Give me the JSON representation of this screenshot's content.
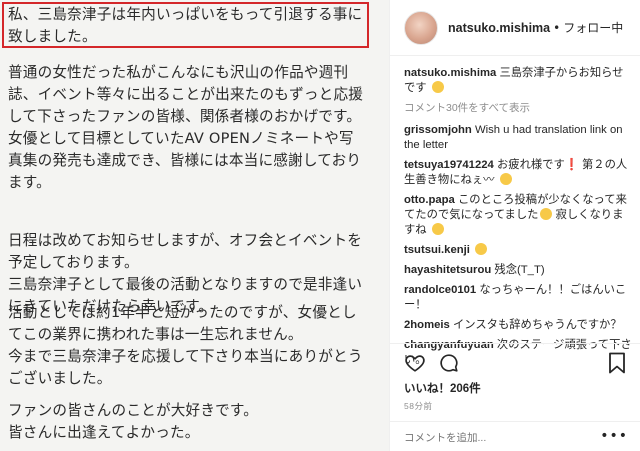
{
  "letter": {
    "highlight": "私、三島奈津子は年内いっぱいをもって引退する事に\n致しました。",
    "para1": "普通の女性だった私がこんなにも沢山の作品や週刊\n誌、イベント等々に出ることが出来たのもずっと応援\nして下さったファンの皆様、関係者様のおかげです。\n女優として目標としていたAV OPENノミネートや写\n真集の発売も達成でき、皆様には本当に感謝しており\nます。",
    "para2": "日程は改めてお知らせしますが、オフ会とイベントを\n予定しております。\n三島奈津子として最後の活動となりますので是非逢い\nにきていただけたら幸いです。",
    "para3": "活動としては約1年半と短かったのですが、女優とし\nてこの業界に携われた事は一生忘れません。\n今まで三島奈津子を応援して下さり本当にありがとう\nございました。",
    "para4": "ファンの皆さんのことが大好きです。\n皆さんに出逢えてよかった。"
  },
  "header": {
    "username": "natsuko.mishima",
    "dot": "•",
    "follow_status": "フォロー中"
  },
  "caption": {
    "user": "natsuko.mishima",
    "text": "三島奈津子からお知らせです"
  },
  "more_comments": "コメント30件をすべて表示",
  "comments": [
    {
      "user": "grissomjohn",
      "text": "Wish u had translation link on the letter"
    },
    {
      "user": "tetsuya19741224",
      "text": "お疲れ様です",
      "mark": "❗",
      "text2": "第２の人生善き物にねぇ〰"
    },
    {
      "user": "otto.papa",
      "text": "このところ投稿が少なくなって来てたので気になってました",
      "text2": "寂しくなりますね"
    },
    {
      "user": "tsutsui.kenji",
      "text": ""
    },
    {
      "user": "hayashitetsurou",
      "text": "残念(T_T)"
    },
    {
      "user": "randolce0101",
      "text": "なっちゃーん！！ごはんいこー！"
    },
    {
      "user": "2homeis",
      "text": "インスタも辞めちゃうんですか？"
    },
    {
      "user": "changyanfuyuan",
      "text": "次のステージ頑張って下さい。"
    }
  ],
  "likes": "いいね！206件",
  "time_ago": "58分前",
  "add_comment_placeholder": "コメントを追加...",
  "more_options": "•••",
  "icons": {
    "like": "heart-icon",
    "comment": "comment-icon",
    "save": "bookmark-icon"
  }
}
